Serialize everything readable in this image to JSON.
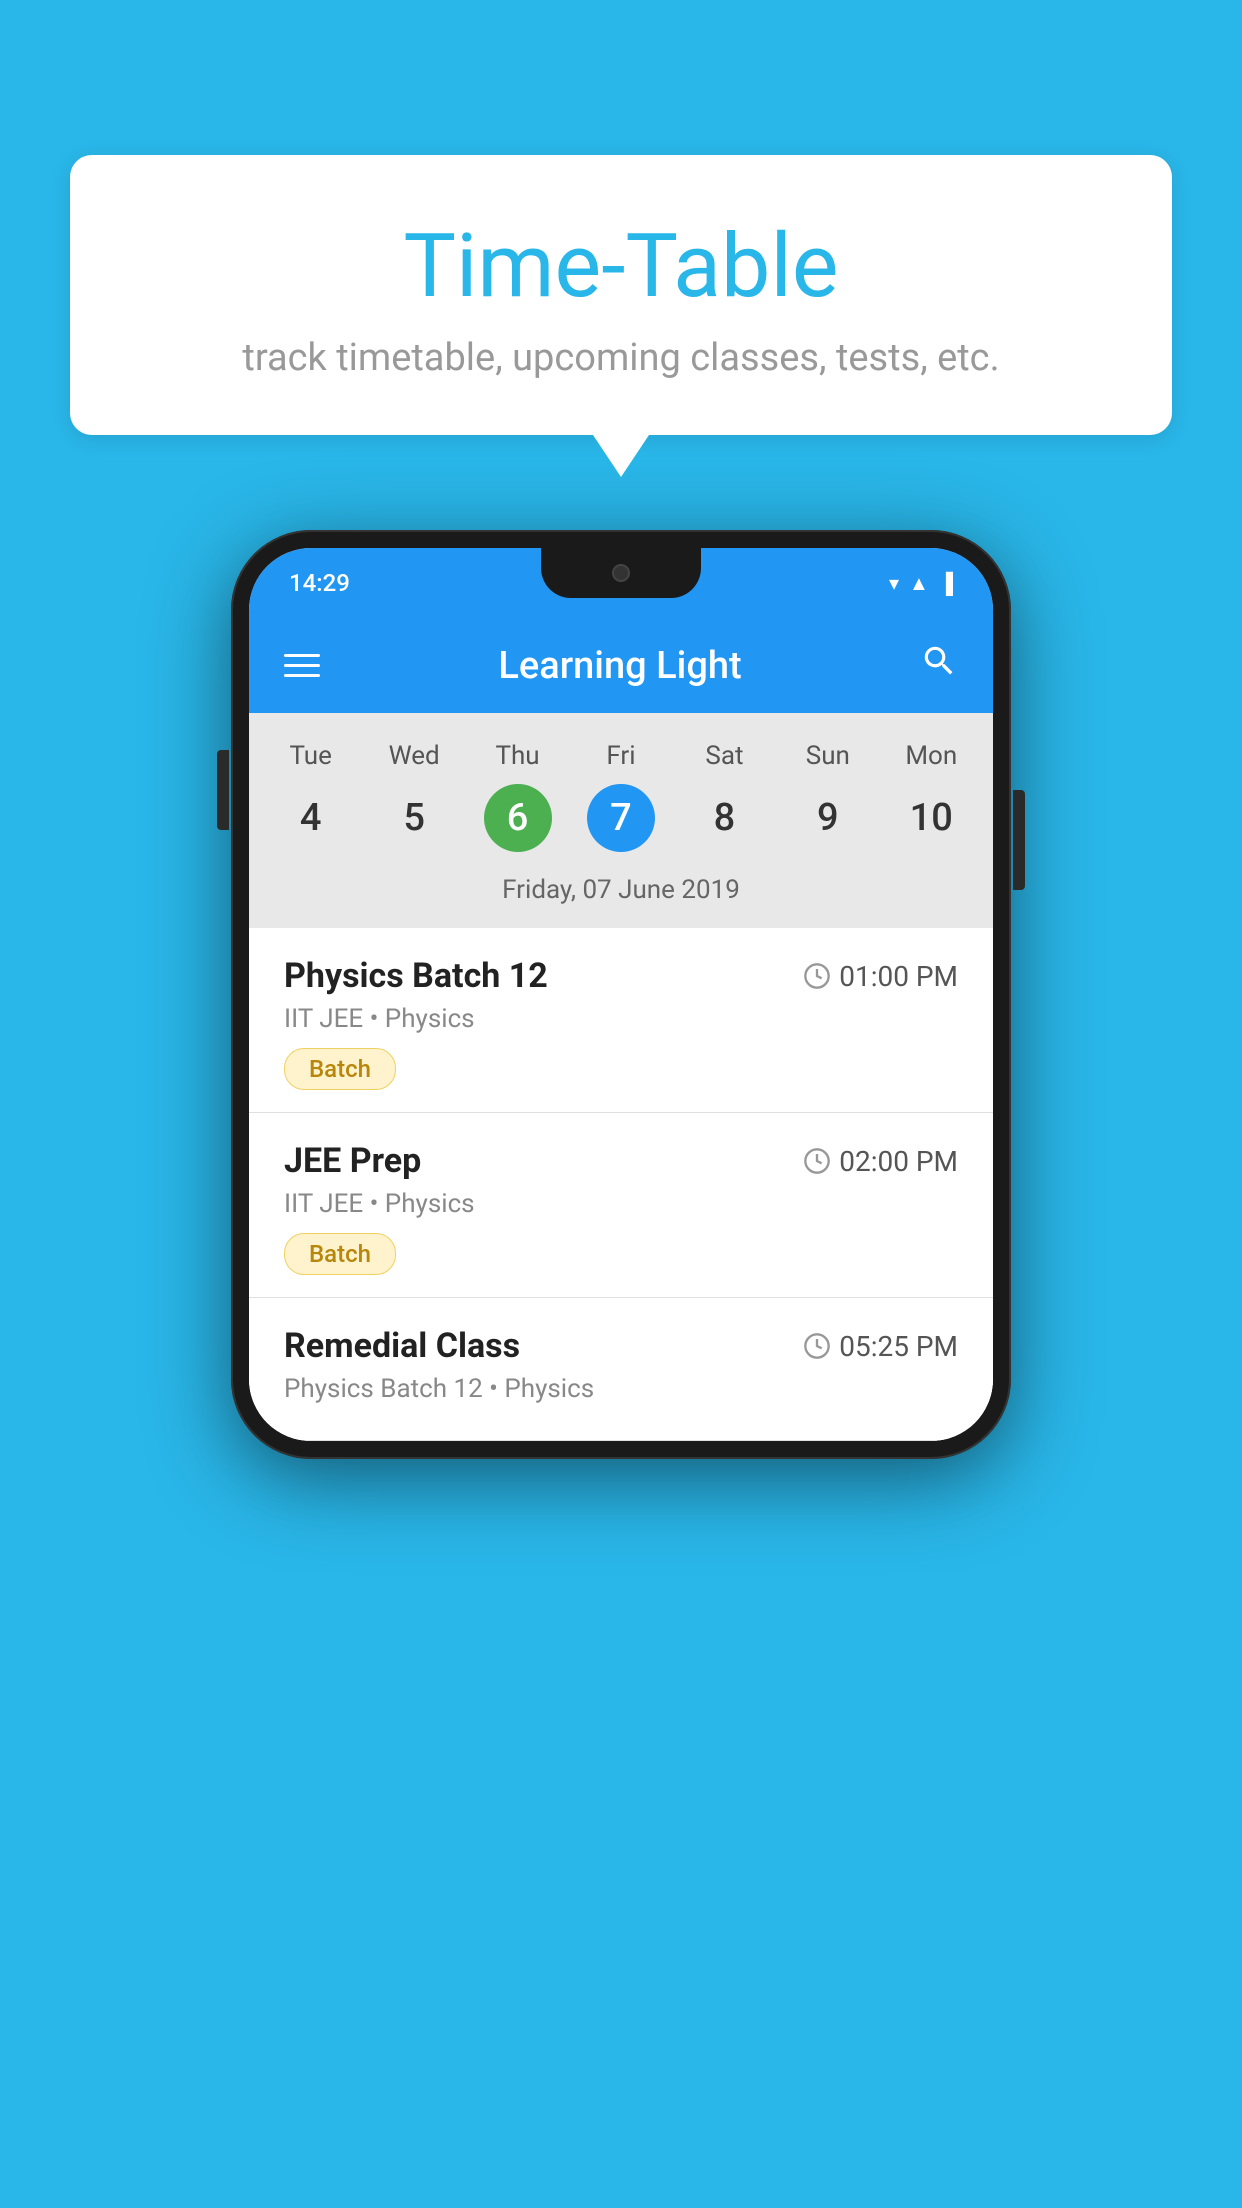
{
  "background_color": "#29b6e8",
  "speech_bubble": {
    "title": "Time-Table",
    "subtitle": "track timetable, upcoming classes, tests, etc."
  },
  "phone": {
    "status_bar": {
      "time": "14:29"
    },
    "app_bar": {
      "title": "Learning Light",
      "menu_icon": "hamburger-icon",
      "search_icon": "search-icon"
    },
    "calendar": {
      "days": [
        {
          "label": "Tue",
          "number": "4"
        },
        {
          "label": "Wed",
          "number": "5"
        },
        {
          "label": "Thu",
          "number": "6",
          "state": "today"
        },
        {
          "label": "Fri",
          "number": "7",
          "state": "selected"
        },
        {
          "label": "Sat",
          "number": "8"
        },
        {
          "label": "Sun",
          "number": "9"
        },
        {
          "label": "Mon",
          "number": "10"
        }
      ],
      "selected_date_label": "Friday, 07 June 2019"
    },
    "schedule": [
      {
        "title": "Physics Batch 12",
        "time": "01:00 PM",
        "subtitle": "IIT JEE • Physics",
        "tag": "Batch"
      },
      {
        "title": "JEE Prep",
        "time": "02:00 PM",
        "subtitle": "IIT JEE • Physics",
        "tag": "Batch"
      },
      {
        "title": "Remedial Class",
        "time": "05:25 PM",
        "subtitle": "Physics Batch 12 • Physics",
        "tag": ""
      }
    ]
  }
}
